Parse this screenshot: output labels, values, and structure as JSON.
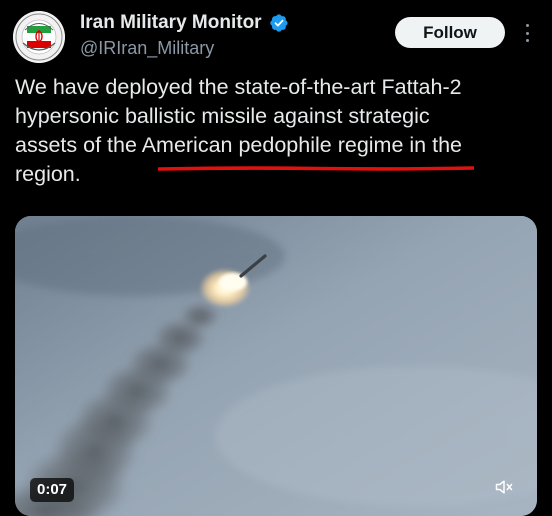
{
  "author": {
    "display_name": "Iran Military Monitor",
    "handle": "@IRIran_Military",
    "verified": true,
    "avatar_icon": "iran-emblem-icon"
  },
  "actions": {
    "follow_label": "Follow",
    "more_icon": "more-options-icon"
  },
  "tweet": {
    "lines": [
      "We have deployed the state-of-the-art Fattah-2",
      "hypersonic ballistic missile against strategic",
      "assets of the American pedophile regime in the",
      "region."
    ],
    "highlight_color": "#e0110f"
  },
  "media": {
    "type": "video",
    "duration": "0:07",
    "mute_icon": "speaker-muted-icon"
  },
  "colors": {
    "background": "#000000",
    "text": "#e7e9ea",
    "secondary_text": "#8b98a5",
    "verified_badge": "#1d9bf0",
    "follow_button_bg": "#eff3f4"
  }
}
